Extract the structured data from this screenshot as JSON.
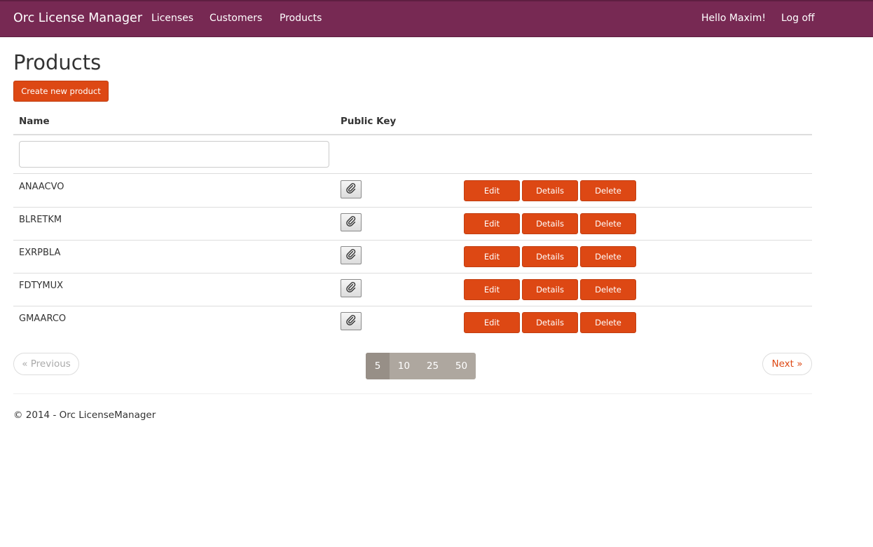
{
  "navbar": {
    "brand": "Orc License Manager",
    "links": [
      "Licenses",
      "Customers",
      "Products"
    ],
    "greeting": "Hello Maxim!",
    "logoff": "Log off",
    "bg_color": "#772953"
  },
  "page": {
    "title": "Products",
    "create_button": "Create new product"
  },
  "table": {
    "headers": [
      "Name",
      "Public Key"
    ],
    "filter_value": "",
    "rows": [
      {
        "name": "ANAACVO"
      },
      {
        "name": "BLRETKM"
      },
      {
        "name": "EXRPBLA"
      },
      {
        "name": "FDTYMUX"
      },
      {
        "name": "GMAARCO"
      }
    ],
    "row_actions": {
      "edit": "Edit",
      "details": "Details",
      "delete": "Delete"
    },
    "key_icon": "paperclip-icon"
  },
  "pager": {
    "previous": "« Previous",
    "next": "Next »",
    "page_sizes": [
      "5",
      "10",
      "25",
      "50"
    ],
    "active_page_size": "5"
  },
  "footer": {
    "text": "© 2014 - Orc LicenseManager"
  },
  "colors": {
    "accent": "#dd4814",
    "navbar": "#772953",
    "pagesize_bg": "#aea79f"
  }
}
